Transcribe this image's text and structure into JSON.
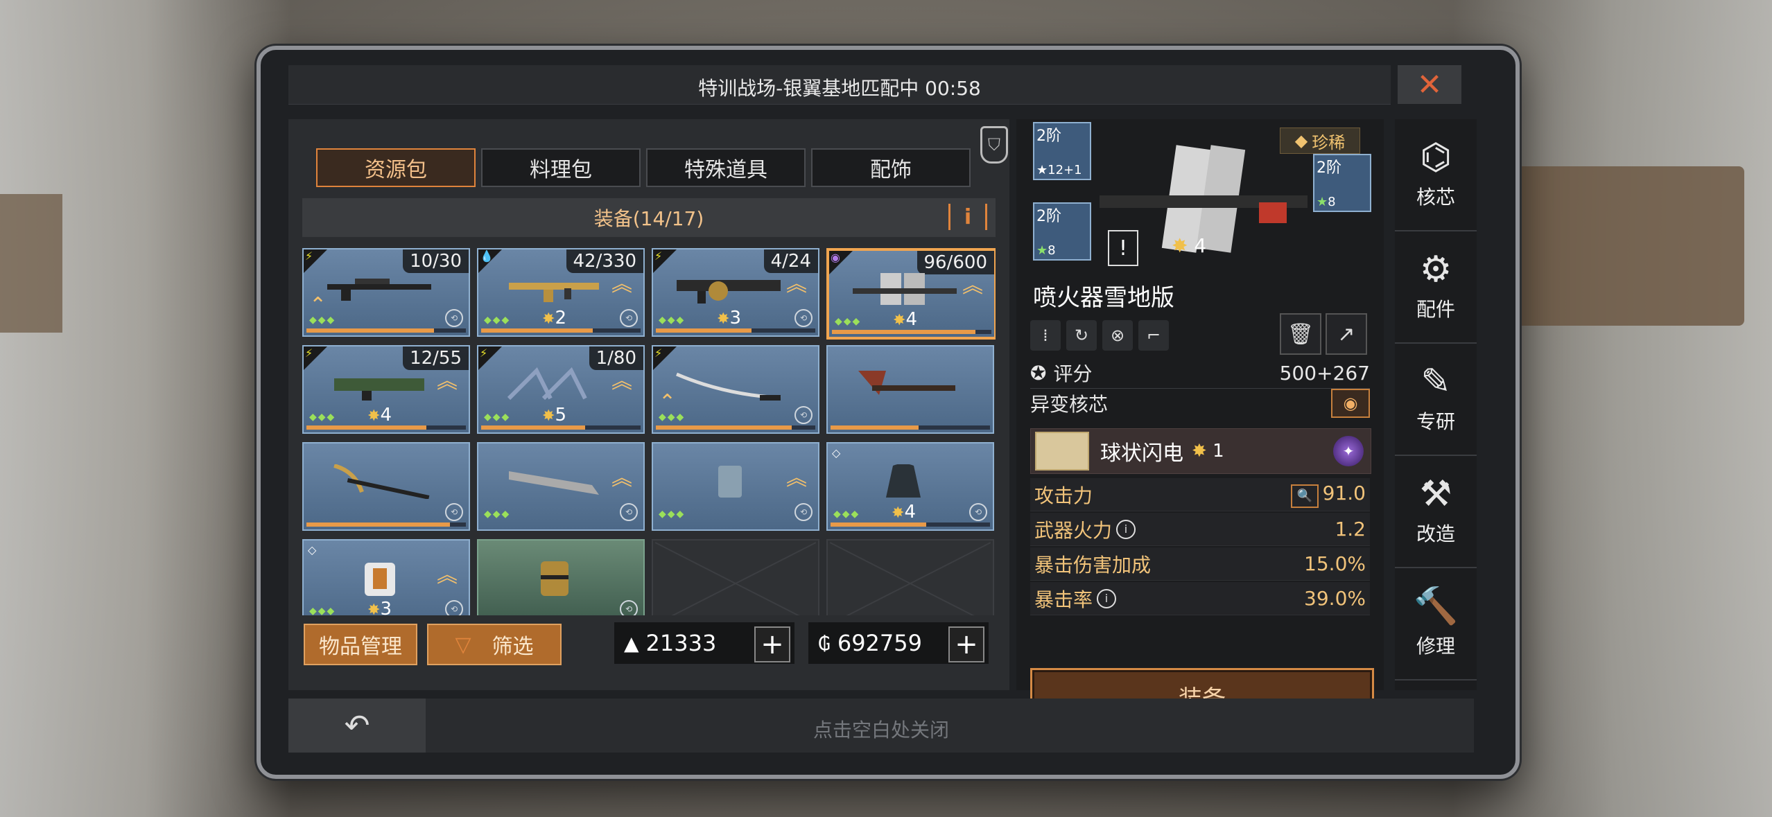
{
  "title": "特训战场-银翼基地匹配中 00:58",
  "tabs": [
    "资源包",
    "料理包",
    "特殊道具",
    "配饰"
  ],
  "section_title": "装备(14/17)",
  "items": [
    {
      "count": "10/30",
      "level": "",
      "kind": "sniper"
    },
    {
      "count": "42/330",
      "level": "2",
      "kind": "rifle"
    },
    {
      "count": "4/24",
      "level": "3",
      "kind": "launcher"
    },
    {
      "count": "96/600",
      "level": "4",
      "kind": "flamer"
    },
    {
      "count": "12/55",
      "level": "4",
      "kind": "rifle2"
    },
    {
      "count": "1/80",
      "level": "5",
      "kind": "claw"
    },
    {
      "count": "",
      "level": "",
      "kind": "katana"
    },
    {
      "count": "",
      "level": "",
      "kind": "axe"
    },
    {
      "count": "",
      "level": "",
      "kind": "pickaxe"
    },
    {
      "count": "",
      "level": "",
      "kind": "machete"
    },
    {
      "count": "",
      "level": "",
      "kind": "vest"
    },
    {
      "count": "",
      "level": "4",
      "kind": "hood"
    },
    {
      "count": "",
      "level": "3",
      "kind": "armor"
    },
    {
      "count": "",
      "level": "",
      "kind": "grenade"
    }
  ],
  "buttons": {
    "manage": "物品管理",
    "filter": "筛选",
    "equip": "装备"
  },
  "resources": {
    "material": "21333",
    "gold": "692759"
  },
  "hint": "点击空白处关闭",
  "detail": {
    "rarity": "珍稀",
    "slot_top_left": {
      "tier": "2阶",
      "level": "12+1"
    },
    "slot_bottom_left": {
      "tier": "2阶",
      "level": "8"
    },
    "slot_right": {
      "tier": "2阶",
      "level": "8"
    },
    "weapon_level": "4",
    "name": "喷火器雪地版",
    "score_label": "评分",
    "score_value": "500+267",
    "mutation_label": "异变核芯",
    "core_name": "球状闪电",
    "core_level": "1",
    "stats": [
      {
        "label": "攻击力",
        "value": "91.0"
      },
      {
        "label": "武器火力",
        "value": "1.2"
      },
      {
        "label": "暴击伤害加成",
        "value": "15.0%"
      },
      {
        "label": "暴击率",
        "value": "39.0%"
      }
    ]
  },
  "side_menu": [
    "核芯",
    "配件",
    "专研",
    "改造",
    "修理"
  ]
}
